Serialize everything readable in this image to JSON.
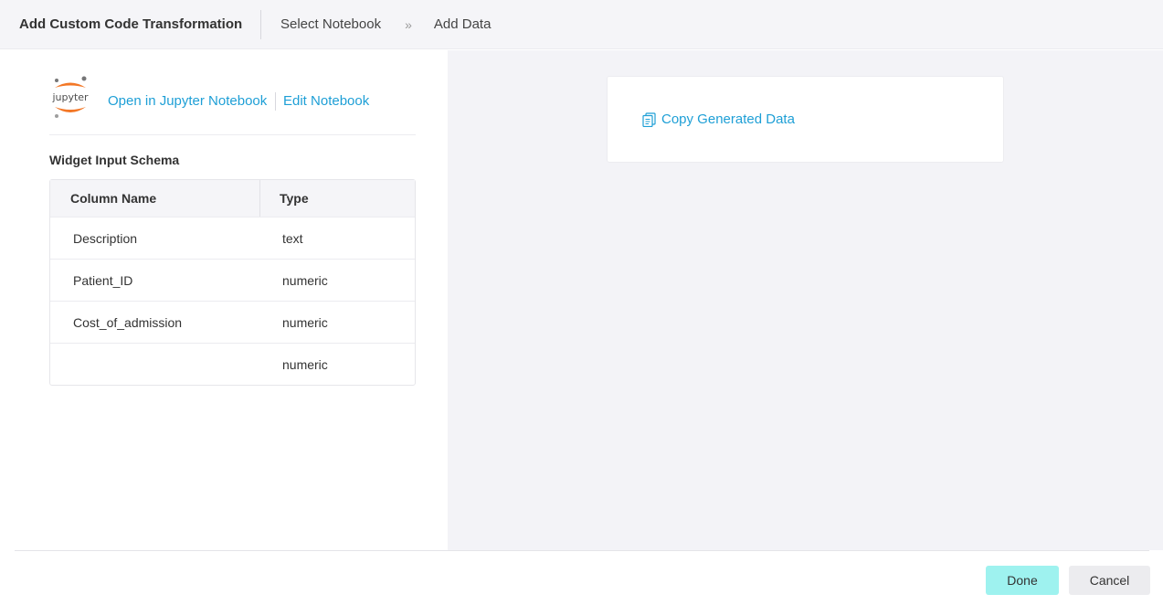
{
  "header": {
    "title": "Add Custom Code Transformation",
    "steps": [
      "Select Notebook",
      "Add Data"
    ],
    "separator": "»"
  },
  "notebook": {
    "logo_text": "jupyter",
    "open_link": "Open in Jupyter Notebook",
    "edit_link": "Edit Notebook"
  },
  "schema": {
    "title": "Widget Input Schema",
    "columns": [
      "Column Name",
      "Type"
    ],
    "rows": [
      {
        "name": "Description",
        "type": "text"
      },
      {
        "name": "Patient_ID",
        "type": "numeric"
      },
      {
        "name": "Cost_of_admission",
        "type": "numeric"
      },
      {
        "name": "",
        "type": "numeric"
      }
    ]
  },
  "copy_card": {
    "label": "Copy Generated Data",
    "icon": "copy-icon"
  },
  "footer": {
    "done_label": "Done",
    "cancel_label": "Cancel"
  },
  "colors": {
    "accent": "#1e9fd6",
    "done_button": "#9ef2ef",
    "jupyter_orange": "#f37726"
  }
}
